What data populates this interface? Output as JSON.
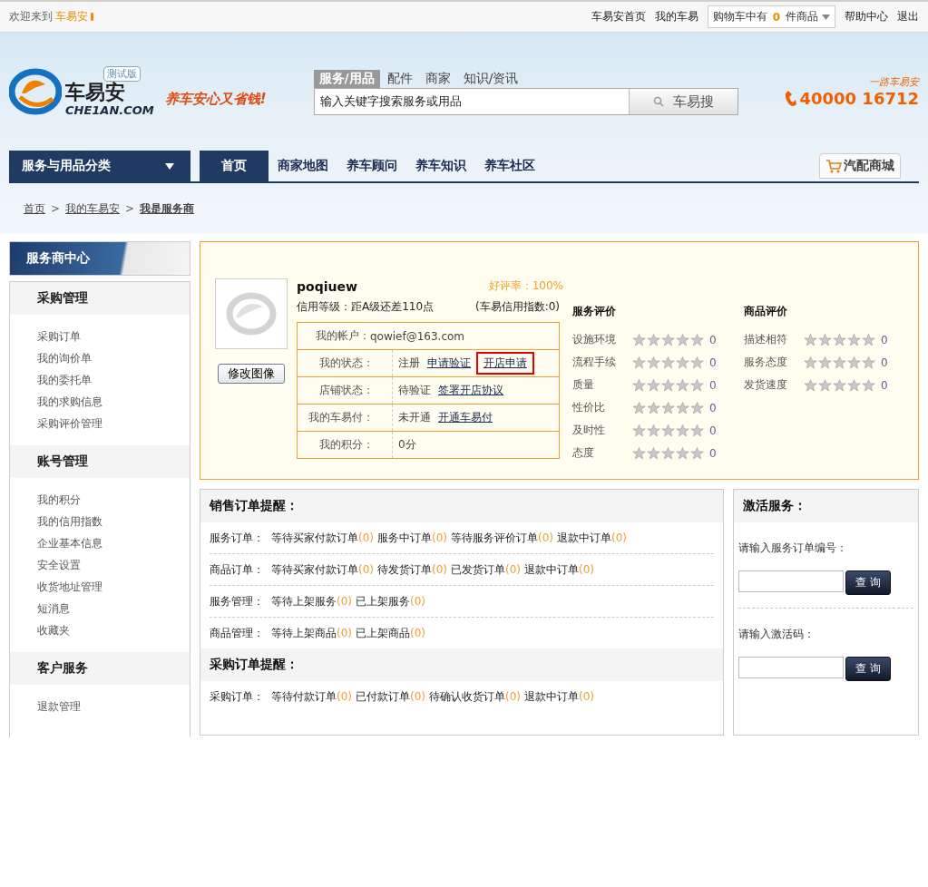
{
  "top_bar": {
    "welcome": "欢迎来到",
    "site_name": "车易安",
    "links": [
      "车易安首页",
      "我的车易"
    ],
    "cart": {
      "prefix": "购物车中有",
      "count": "0",
      "suffix": "件商品"
    },
    "links_right": [
      "帮助中心",
      "退出"
    ]
  },
  "header": {
    "logo_text": "车易安",
    "logo_domain": "CHE1AN.COM",
    "beta_badge": "测试版",
    "slogan": "养车安心又省钱!",
    "search": {
      "tabs": [
        {
          "label": "服务/用品",
          "selected": true
        },
        {
          "label": "配件",
          "selected": false
        },
        {
          "label": "商家",
          "selected": false
        },
        {
          "label": "知识/资讯",
          "selected": false
        }
      ],
      "value": "输入关键字搜索服务或用品",
      "button": "车易搜"
    },
    "hotline": {
      "tagline": "一路车易安",
      "number": "40000 16712"
    }
  },
  "nav": {
    "category_menu": "服务与用品分类",
    "tabs": [
      {
        "label": "首页",
        "selected": true
      },
      {
        "label": "商家地图",
        "selected": false
      },
      {
        "label": "养车顾问",
        "selected": false
      },
      {
        "label": "养车知识",
        "selected": false
      },
      {
        "label": "养车社区",
        "selected": false
      }
    ],
    "shop_button": "汽配商城"
  },
  "breadcrumb": [
    {
      "label": "首页",
      "current": false
    },
    {
      "separator": ">",
      "label": "我的车易安",
      "current": false
    },
    {
      "separator": ">",
      "label": "我是服务商",
      "current": true
    }
  ],
  "sidebar": {
    "title": "服务商中心",
    "sections": [
      {
        "heading": "采购管理",
        "items": [
          "采购订单",
          "我的询价单",
          "我的委托单",
          "我的求购信息",
          "采购评价管理"
        ]
      },
      {
        "heading": "账号管理",
        "items": [
          "我的积分",
          "我的信用指数",
          "企业基本信息",
          "安全设置",
          "收货地址管理",
          "短消息",
          "收藏夹"
        ]
      },
      {
        "heading": "客户服务",
        "items": [
          "退款管理"
        ]
      }
    ]
  },
  "profile": {
    "username": "poqiuew",
    "rating_label": "好评率：100%",
    "credit_level": "信用等级：距A级还差110点",
    "credit_index": "(车易信用指数:0)",
    "change_avatar": "修改图像",
    "rows": [
      {
        "kind": "wide",
        "label": "我的帐户：",
        "value": "qowief@163.com",
        "links": []
      },
      {
        "kind": "split",
        "label": "我的状态：",
        "value": "注册",
        "links": [
          {
            "label": "申请验证",
            "highlighted": false
          },
          {
            "label": "开店申请",
            "highlighted": true
          }
        ]
      },
      {
        "kind": "split",
        "label": "店铺状态：",
        "value": "待验证",
        "links": [
          {
            "label": "签署开店协议",
            "highlighted": false
          }
        ]
      },
      {
        "kind": "split",
        "label": "我的车易付：",
        "value": "未开通",
        "links": [
          {
            "label": "开通车易付",
            "highlighted": false
          }
        ]
      },
      {
        "kind": "split",
        "label": "我的积分：",
        "value": "0分",
        "links": []
      }
    ],
    "ratings": [
      {
        "title": "服务评价",
        "items": [
          {
            "label": "设施环境",
            "stars": 0,
            "reading": "0"
          },
          {
            "label": "流程手续",
            "stars": 0,
            "reading": "0"
          },
          {
            "label": "质量",
            "stars": 0,
            "reading": "0"
          },
          {
            "label": "性价比",
            "stars": 0,
            "reading": "0"
          },
          {
            "label": "及时性",
            "stars": 0,
            "reading": "0"
          },
          {
            "label": "态度",
            "stars": 0,
            "reading": "0"
          }
        ]
      },
      {
        "title": "商品评价",
        "items": [
          {
            "label": "描述相符",
            "stars": 0,
            "reading": "0"
          },
          {
            "label": "服务态度",
            "stars": 0,
            "reading": "0"
          },
          {
            "label": "发货速度",
            "stars": 0,
            "reading": "0"
          }
        ]
      }
    ]
  },
  "reminders": [
    {
      "title": "销售订单提醒：",
      "rows": [
        {
          "label": "服务订单：",
          "items": [
            {
              "label": "等待买家付款订单",
              "count": "(0)"
            },
            {
              "label": "服务中订单",
              "count": "(0)"
            },
            {
              "label": "等待服务评价订单",
              "count": "(0)"
            },
            {
              "label": "退款中订单",
              "count": "(0)"
            }
          ]
        },
        {
          "label": "商品订单：",
          "items": [
            {
              "label": "等待买家付款订单",
              "count": "(0)"
            },
            {
              "label": "待发货订单",
              "count": "(0)"
            },
            {
              "label": "已发货订单",
              "count": "(0)"
            },
            {
              "label": "退款中订单",
              "count": "(0)"
            }
          ]
        },
        {
          "label": "服务管理：",
          "items": [
            {
              "label": "等待上架服务",
              "count": "(0)"
            },
            {
              "label": "已上架服务",
              "count": "(0)"
            }
          ]
        },
        {
          "label": "商品管理：",
          "items": [
            {
              "label": "等待上架商品",
              "count": "(0)"
            },
            {
              "label": "已上架商品",
              "count": "(0)"
            }
          ]
        }
      ]
    },
    {
      "title": "采购订单提醒：",
      "rows": [
        {
          "label": "采购订单：",
          "items": [
            {
              "label": "等待付款订单",
              "count": "(0)"
            },
            {
              "label": "已付款订单",
              "count": "(0)"
            },
            {
              "label": "待确认收货订单",
              "count": "(0)"
            },
            {
              "label": "退款中订单",
              "count": "(0)"
            }
          ]
        }
      ]
    }
  ],
  "activation": {
    "title": "激活服务：",
    "forms": [
      {
        "label": "请输入服务订单编号：",
        "button": "查 询"
      },
      {
        "label": "请输入激活码：",
        "button": "查 询"
      }
    ]
  }
}
